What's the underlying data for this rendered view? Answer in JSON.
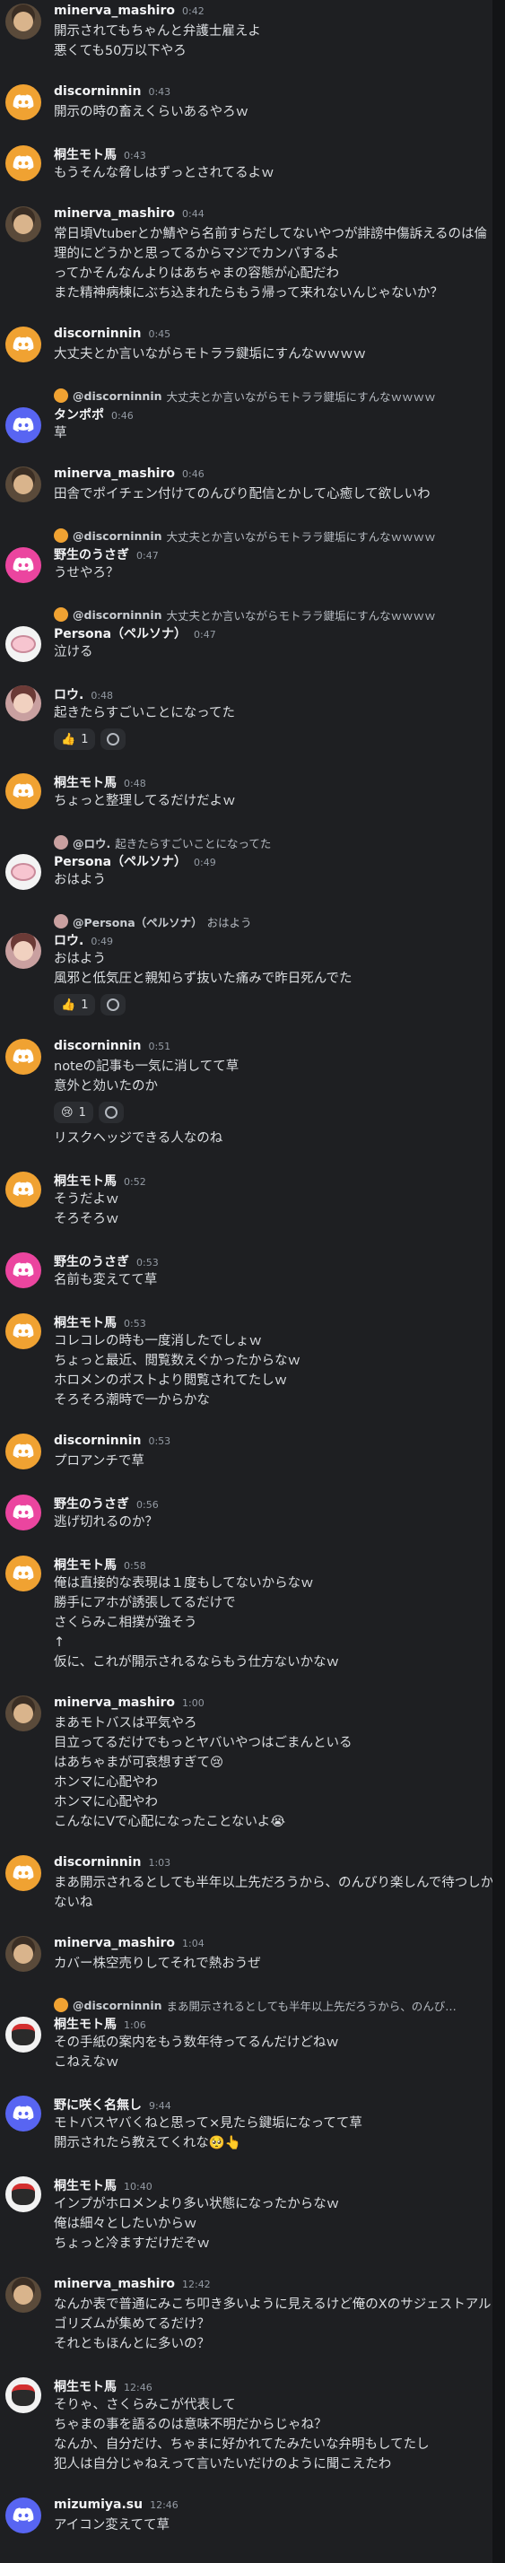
{
  "colors": {
    "background": "#1e1f22",
    "discord_orange": "#f0a232",
    "discord_pink": "#eb459f",
    "discord_blurple": "#5865f2"
  },
  "messages": [
    {
      "author": "minerva_mashiro",
      "time": "0:42",
      "avatar": "photo",
      "lines": [
        "開示されてもちゃんと弁護士雇えよ",
        "悪くても50万以下やろ"
      ]
    },
    {
      "author": "discorninnin",
      "time": "0:43",
      "avatar": "orange",
      "lines": [
        "開示の時の畜えくらいあるやろｗ"
      ]
    },
    {
      "author": "桐生モト馬",
      "time": "0:43",
      "avatar": "orange",
      "lines": [
        "もうそんな脅しはずっとされてるよｗ"
      ]
    },
    {
      "author": "minerva_mashiro",
      "time": "0:44",
      "avatar": "photo",
      "lines": [
        "常日頃Vtuberとか鯖やら名前すらだしてないやつが誹謗中傷訴えるのは倫理的にどうかと思ってるからマジでカンパするよ",
        "ってかそんなんよりはあちゃまの容態が心配だわ",
        "また精神病棟にぶち込まれたらもう帰って来れないんじゃないか？"
      ]
    },
    {
      "author": "discorninnin",
      "time": "0:45",
      "avatar": "orange",
      "lines": [
        "大丈夫とか言いながらモトララ鍵垢にすんなｗｗｗｗ"
      ]
    },
    {
      "reply": {
        "who": "@discorninnin",
        "text": "大丈夫とか言いながらモトララ鍵垢にすんなｗｗｗｗ",
        "mini": "orange"
      },
      "author": "タンポポ",
      "time": "0:46",
      "avatar": "blurple",
      "lines": [
        "草"
      ]
    },
    {
      "author": "minerva_mashiro",
      "time": "0:46",
      "avatar": "photo",
      "lines": [
        "田舎でポイチェン付けてのんびり配信とかして心癒して欲しいわ"
      ]
    },
    {
      "reply": {
        "who": "@discorninnin",
        "text": "大丈夫とか言いながらモトララ鍵垢にすんなｗｗｗｗ",
        "mini": "orange"
      },
      "author": "野生のうさぎ",
      "time": "0:47",
      "avatar": "pink",
      "lines": [
        "うせやろ？"
      ]
    },
    {
      "reply": {
        "who": "@discorninnin",
        "text": "大丈夫とか言いながらモトララ鍵垢にすんなｗｗｗｗ",
        "mini": "orange"
      },
      "author": "Persona（ペルソナ）",
      "time": "0:47",
      "avatar": "pig",
      "lines": [
        "泣ける"
      ]
    },
    {
      "author": "ロウ.",
      "time": "0:48",
      "avatar": "girl",
      "lines": [
        "起きたらすごいことになってた"
      ],
      "reactions": [
        {
          "emoji": "👍",
          "count": "1"
        }
      ],
      "add": true
    },
    {
      "author": "桐生モト馬",
      "time": "0:48",
      "avatar": "orange",
      "lines": [
        "ちょっと整理してるだけだよｗ"
      ]
    },
    {
      "reply": {
        "who": "@ロウ.",
        "text": "起きたらすごいことになってた",
        "mini": "girl"
      },
      "author": "Persona（ペルソナ）",
      "time": "0:49",
      "avatar": "pig",
      "lines": [
        "おはよう"
      ]
    },
    {
      "reply": {
        "who": "@Persona（ペルソナ）",
        "text": "おはよう",
        "mini": "pig"
      },
      "author": "ロウ.",
      "time": "0:49",
      "avatar": "girl",
      "lines": [
        "おはよう",
        "風邪と低気圧と親知らず抜いた痛みで昨日死んでた"
      ],
      "reactions": [
        {
          "emoji": "👍",
          "count": "1"
        }
      ],
      "add": true
    },
    {
      "author": "discorninnin",
      "time": "0:51",
      "avatar": "orange",
      "lines": [
        "noteの記事も一気に消してて草",
        "意外と効いたのか"
      ],
      "reactions": [
        {
          "emoji": "😢",
          "count": "1"
        }
      ],
      "add": true,
      "after": [
        "リスクヘッジできる人なのね"
      ]
    },
    {
      "author": "桐生モト馬",
      "time": "0:52",
      "avatar": "orange",
      "lines": [
        "そうだよｗ",
        "そろそろｗ"
      ]
    },
    {
      "author": "野生のうさぎ",
      "time": "0:53",
      "avatar": "pink",
      "lines": [
        "名前も変えてて草"
      ]
    },
    {
      "author": "桐生モト馬",
      "time": "0:53",
      "avatar": "orange",
      "lines": [
        "コレコレの時も一度消したでしょｗ",
        "ちょっと最近、閲覧数えぐかったからなｗ",
        "ホロメンのポストより閲覧されてたしｗ",
        "そろそろ潮時で一からかな"
      ]
    },
    {
      "author": "discorninnin",
      "time": "0:53",
      "avatar": "orange",
      "lines": [
        "プロアンチで草"
      ]
    },
    {
      "author": "野生のうさぎ",
      "time": "0:56",
      "avatar": "pink",
      "lines": [
        "逃げ切れるのか？"
      ]
    },
    {
      "author": "桐生モト馬",
      "time": "0:58",
      "avatar": "orange",
      "lines": [
        "俺は直接的な表現は１度もしてないからなｗ",
        "勝手にアホが誘張してるだけで",
        "さくらみこ相撲が強そう",
        "↑",
        "仮に、これが開示されるならもう仕方ないかなｗ"
      ]
    },
    {
      "author": "minerva_mashiro",
      "time": "1:00",
      "avatar": "photo",
      "lines": [
        "まあモトバスは平気やろ",
        "目立ってるだけでもっとヤバいやつはごまんといる",
        "はあちゃまが可哀想すぎて😢",
        "ホンマに心配やわ",
        "ホンマに心配やわ",
        "こんなにVで心配になったことないよ😭"
      ]
    },
    {
      "author": "discorninnin",
      "time": "1:03",
      "avatar": "orange",
      "lines": [
        "まあ開示されるとしても半年以上先だろうから、のんびり楽しんで待つしかないね"
      ]
    },
    {
      "author": "minerva_mashiro",
      "time": "1:04",
      "avatar": "photo",
      "lines": [
        "カバー株空売りしてそれで熱おうぜ"
      ]
    },
    {
      "reply": {
        "who": "@discorninnin",
        "text": "まあ開示されるとしても半年以上先だろうから、のんび…",
        "mini": "orange"
      },
      "author": "桐生モト馬",
      "time": "1:06",
      "avatar": "ninja",
      "lines": [
        "その手紙の案内をもう数年待ってるんだけどねｗ",
        "こねえなｗ"
      ]
    },
    {
      "author": "野に咲く名無し",
      "time": "9:44",
      "avatar": "blurple",
      "lines": [
        "モトバスヤバくねと思って×見たら鍵垢になってて草",
        "開示されたら教えてくれな🥺👆"
      ]
    },
    {
      "author": "桐生モト馬",
      "time": "10:40",
      "avatar": "ninja",
      "lines": [
        "インプがホロメンより多い状態になったからなｗ",
        "俺は細々としたいからｗ",
        "ちょっと冷ますだけだぞｗ"
      ]
    },
    {
      "author": "minerva_mashiro",
      "time": "12:42",
      "avatar": "photo",
      "lines": [
        "なんか表で普通にみこち叩き多いように見えるけど俺のXのサジェストアルゴリズムが集めてるだけ？",
        "それともほんとに多いの？"
      ]
    },
    {
      "author": "桐生モト馬",
      "time": "12:46",
      "avatar": "ninja",
      "lines": [
        "そりゃ、さくらみこが代表して",
        "ちゃまの事を語るのは意味不明だからじゃね？",
        "なんか、自分だけ、ちゃまに好かれてたみたいな弁明もしてたし",
        "犯人は自分じゃねえって言いたいだけのように聞こえたわ"
      ]
    },
    {
      "author": "mizumiya.su",
      "time": "12:46",
      "avatar": "blurple",
      "lines": [
        "アイコン変えてて草"
      ]
    }
  ]
}
